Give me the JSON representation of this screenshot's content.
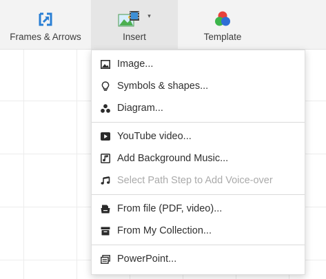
{
  "toolbar": {
    "frames_arrows": {
      "label": "Frames & Arrows",
      "icon": "frame-arrow-icon"
    },
    "insert": {
      "label": "Insert",
      "icon": "insert-media-icon",
      "caret": "▾",
      "active": true
    },
    "template": {
      "label": "Template",
      "icon": "template-palette-icon"
    }
  },
  "menu": {
    "groups": [
      [
        {
          "label": "Image...",
          "icon": "image-icon",
          "enabled": true
        },
        {
          "label": "Symbols & shapes...",
          "icon": "lightbulb-icon",
          "enabled": true
        },
        {
          "label": "Diagram...",
          "icon": "diagram-icon",
          "enabled": true
        }
      ],
      [
        {
          "label": "YouTube video...",
          "icon": "youtube-icon",
          "enabled": true
        },
        {
          "label": "Add Background Music...",
          "icon": "music-file-icon",
          "enabled": true
        },
        {
          "label": "Select Path Step to Add Voice-over",
          "icon": "music-note-icon",
          "enabled": false
        }
      ],
      [
        {
          "label": "From file (PDF, video)...",
          "icon": "file-tray-icon",
          "enabled": true
        },
        {
          "label": "From My Collection...",
          "icon": "collection-icon",
          "enabled": true
        }
      ],
      [
        {
          "label": "PowerPoint...",
          "icon": "powerpoint-icon",
          "enabled": true
        }
      ]
    ]
  },
  "colors": {
    "frames_icon_blue": "#2a7fd4",
    "template_red": "#e8413b",
    "template_green": "#3cb54a",
    "template_blue": "#2f6fd6",
    "insert_green": "#4caf50",
    "insert_sky": "#3d8fd6",
    "disabled_text": "#aaaaaa"
  }
}
